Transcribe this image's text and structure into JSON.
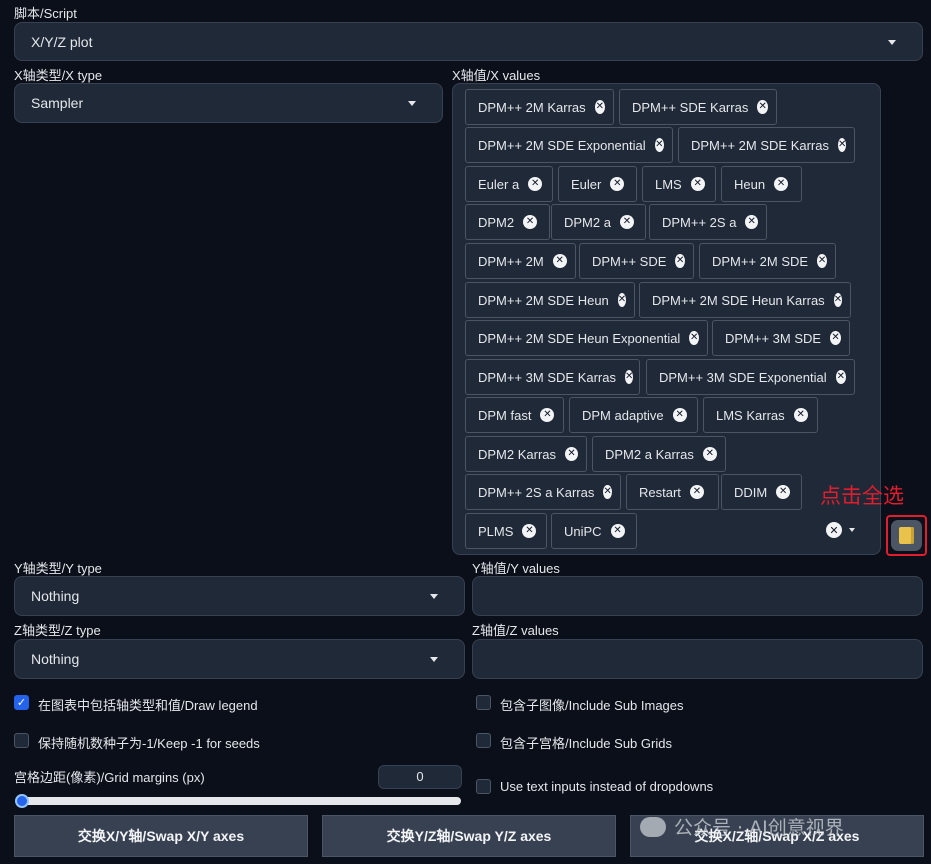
{
  "script": {
    "label": "脚本/Script",
    "value": "X/Y/Z plot"
  },
  "x_type": {
    "label": "X轴类型/X type",
    "value": "Sampler"
  },
  "x_values": {
    "label": "X轴值/X values",
    "chips": [
      "DPM++ 2M Karras",
      "DPM++ SDE Karras",
      "DPM++ 2M SDE Exponential",
      "DPM++ 2M SDE Karras",
      "Euler a",
      "Euler",
      "LMS",
      "Heun",
      "DPM2",
      "DPM2 a",
      "DPM++ 2S a",
      "DPM++ 2M",
      "DPM++ SDE",
      "DPM++ 2M SDE",
      "DPM++ 2M SDE Heun",
      "DPM++ 2M SDE Heun Karras",
      "DPM++ 2M SDE Heun Exponential",
      "DPM++ 3M SDE",
      "DPM++ 3M SDE Karras",
      "DPM++ 3M SDE Exponential",
      "DPM fast",
      "DPM adaptive",
      "LMS Karras",
      "DPM2 Karras",
      "DPM2 a Karras",
      "DPM++ 2S a Karras",
      "Restart",
      "DDIM",
      "PLMS",
      "UniPC"
    ]
  },
  "annotation": "点击全选",
  "y_type": {
    "label": "Y轴类型/Y type",
    "value": "Nothing"
  },
  "y_values": {
    "label": "Y轴值/Y values",
    "value": ""
  },
  "z_type": {
    "label": "Z轴类型/Z type",
    "value": "Nothing"
  },
  "z_values": {
    "label": "Z轴值/Z values",
    "value": ""
  },
  "options": {
    "draw_legend": {
      "label": "在图表中包括轴类型和值/Draw legend",
      "checked": true
    },
    "keep_seeds": {
      "label": "保持随机数种子为-1/Keep -1 for seeds",
      "checked": false
    },
    "include_sub_images": {
      "label": "包含子图像/Include Sub Images",
      "checked": false
    },
    "include_sub_grids": {
      "label": "包含子宫格/Include Sub Grids",
      "checked": false
    },
    "use_text_inputs": {
      "label": "Use text inputs instead of dropdowns",
      "checked": false
    }
  },
  "grid_margins": {
    "label": "宫格边距(像素)/Grid margins (px)",
    "value": "0",
    "slider_fraction": 0
  },
  "buttons": {
    "swap_xy": "交换X/Y轴/Swap X/Y axes",
    "swap_yz": "交换Y/Z轴/Swap Y/Z axes",
    "swap_xz": "交换X/Z轴/Swap X/Z axes"
  },
  "watermark": "公众号 · AI创意视界",
  "colors": {
    "accent": "#2563eb",
    "annotation": "#e11d2e",
    "background": "#0b0f19",
    "panel": "#1f2937"
  }
}
